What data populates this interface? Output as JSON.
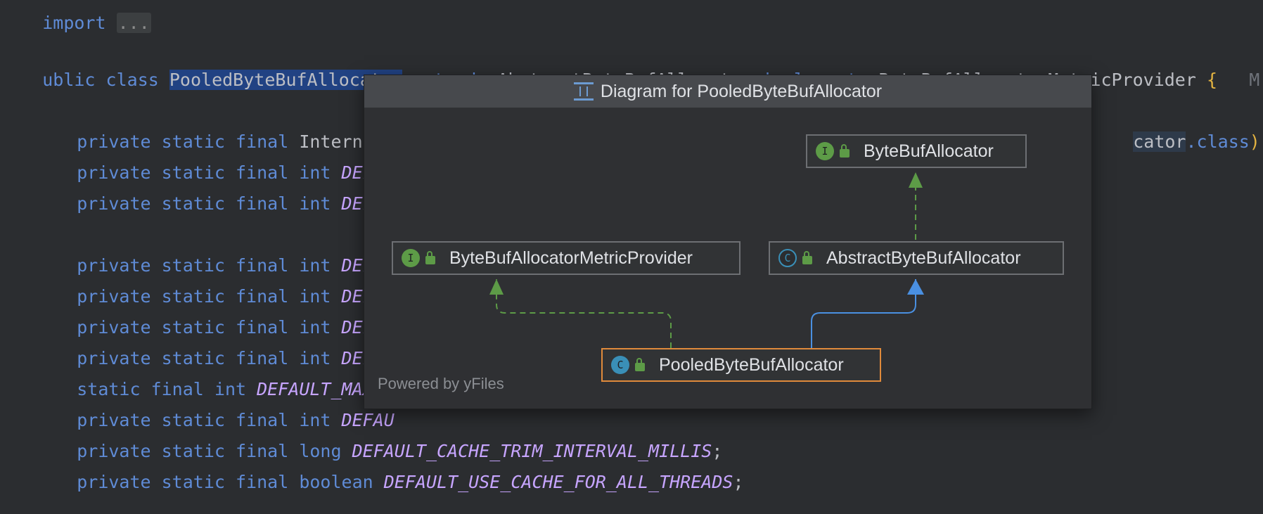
{
  "code": {
    "line_import_kw": "import",
    "line_import_fold": "...",
    "class_decl": {
      "kw_public": "ublic",
      "kw_class": "class",
      "class_name": "PooledByteBufAllocator",
      "kw_extends": "extends",
      "superclass": "AbstractByteBufAllocator",
      "kw_implements": "implements",
      "interface": "ByteBufAllocatorMetricProvider",
      "brace": "{",
      "trailing": "M"
    },
    "lines": [
      {
        "kw": "private static final",
        "type": "InternalL",
        "tail": "cator",
        "tail2": ".class",
        "tail3": ");"
      },
      {
        "kw": "private static final",
        "type": "int",
        "const": "DEFAU"
      },
      {
        "kw": "private static final",
        "type": "int",
        "const": "DEFAU"
      },
      {
        "kw": "private static final",
        "type": "int",
        "const": "DEFAU"
      },
      {
        "kw": "private static final",
        "type": "int",
        "const": "DEFAU"
      },
      {
        "kw": "private static final",
        "type": "int",
        "const": "DEFAU"
      },
      {
        "kw": "private static final",
        "type": "int",
        "const": "DEFAU"
      },
      {
        "kw": "static final",
        "type": "int",
        "const": "DEFAULT_MAX_C"
      },
      {
        "kw": "private static final",
        "type": "int",
        "const": "DEFAU"
      },
      {
        "kw": "private static final",
        "type": "long",
        "const": "DEFAULT_CACHE_TRIM_INTERVAL_MILLIS",
        "end": ";"
      },
      {
        "kw": "private static final",
        "type": "boolean",
        "const": "DEFAULT_USE_CACHE_FOR_ALL_THREADS",
        "end": ";"
      }
    ]
  },
  "popup": {
    "title": "Diagram for PooledByteBufAllocator",
    "footer": "Powered by yFiles",
    "nodes": {
      "byte_buf_allocator": {
        "badge": "I",
        "label": "ByteBufAllocator",
        "kind": "interface"
      },
      "metric_provider": {
        "badge": "I",
        "label": "ByteBufAllocatorMetricProvider",
        "kind": "interface"
      },
      "abstract_allocator": {
        "badge": "C",
        "label": "AbstractByteBufAllocator",
        "kind": "abstract-class"
      },
      "pooled_allocator": {
        "badge": "C",
        "label": "PooledByteBufAllocator",
        "kind": "class"
      }
    },
    "colors": {
      "implements_edge": "#5d9b47",
      "extends_edge": "#4a90e2",
      "focus_border": "#e08a3b"
    }
  }
}
